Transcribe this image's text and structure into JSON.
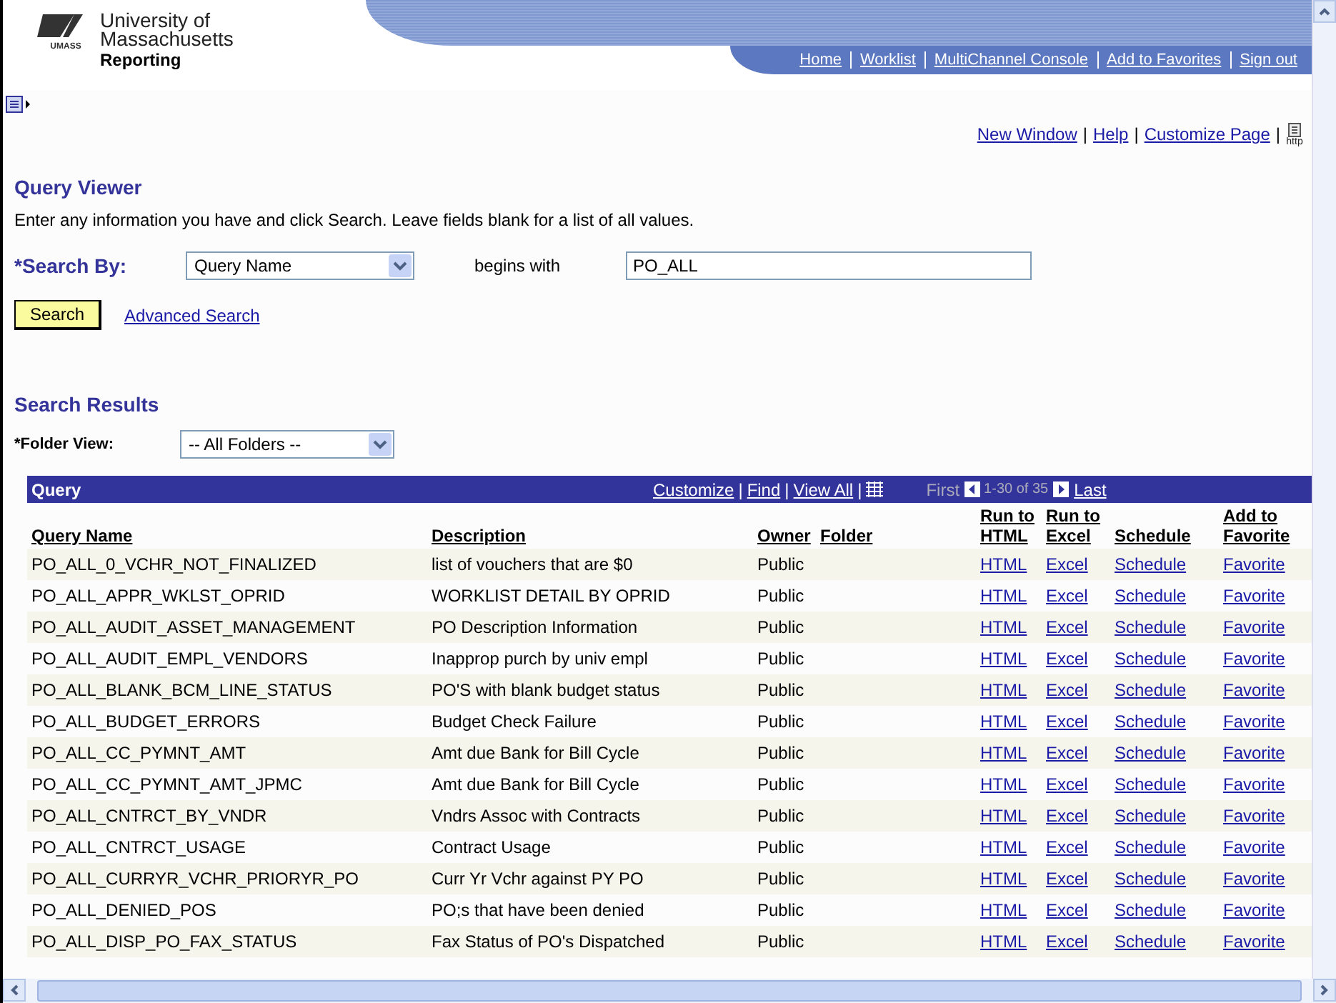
{
  "header": {
    "logo_lines": [
      "University of",
      "Massachusetts"
    ],
    "logo_small": "UMASS",
    "app_name": "Reporting",
    "nav": [
      "Home",
      "Worklist",
      "MultiChannel Console",
      "Add to Favorites",
      "Sign out"
    ]
  },
  "page_links": [
    "New Window",
    "Help",
    "Customize Page"
  ],
  "separator": "|",
  "http_label": "http",
  "title": "Query Viewer",
  "instructions": "Enter any information you have and click Search. Leave fields blank for a list of all values.",
  "search": {
    "label": "*Search By:",
    "field": "Query Name",
    "operator": "begins with",
    "value": "PO_ALL",
    "button": "Search",
    "advanced": "Advanced Search"
  },
  "results_title": "Search Results",
  "folder": {
    "label": "*Folder View:",
    "value": "-- All Folders --"
  },
  "grid": {
    "title": "Query",
    "tools": [
      "Customize",
      "Find",
      "View All"
    ],
    "first": "First",
    "range": "1-30 of 35",
    "last": "Last",
    "columns": [
      {
        "label": "Query Name"
      },
      {
        "label": "Description"
      },
      {
        "label": "Owner"
      },
      {
        "label": "Folder"
      },
      {
        "label": "Run to HTML"
      },
      {
        "label": "Run to Excel"
      },
      {
        "label": "Schedule"
      },
      {
        "label": "Add to Favorite"
      }
    ],
    "rows": [
      {
        "name": "PO_ALL_0_VCHR_NOT_FINALIZED",
        "description": "list of vouchers that are $0",
        "owner": "Public",
        "html": "HTML",
        "excel": "Excel",
        "schedule": "Schedule",
        "favorite": "Favorite"
      },
      {
        "name": "PO_ALL_APPR_WKLST_OPRID",
        "description": "WORKLIST DETAIL BY OPRID",
        "owner": "Public",
        "html": "HTML",
        "excel": "Excel",
        "schedule": "Schedule",
        "favorite": "Favorite"
      },
      {
        "name": "PO_ALL_AUDIT_ASSET_MANAGEMENT",
        "description": "PO Description Information",
        "owner": "Public",
        "html": "HTML",
        "excel": "Excel",
        "schedule": "Schedule",
        "favorite": "Favorite"
      },
      {
        "name": "PO_ALL_AUDIT_EMPL_VENDORS",
        "description": "Inapprop purch by univ empl",
        "owner": "Public",
        "html": "HTML",
        "excel": "Excel",
        "schedule": "Schedule",
        "favorite": "Favorite"
      },
      {
        "name": "PO_ALL_BLANK_BCM_LINE_STATUS",
        "description": "PO'S with blank budget status",
        "owner": "Public",
        "html": "HTML",
        "excel": "Excel",
        "schedule": "Schedule",
        "favorite": "Favorite"
      },
      {
        "name": "PO_ALL_BUDGET_ERRORS",
        "description": "Budget Check Failure",
        "owner": "Public",
        "html": "HTML",
        "excel": "Excel",
        "schedule": "Schedule",
        "favorite": "Favorite"
      },
      {
        "name": "PO_ALL_CC_PYMNT_AMT",
        "description": "Amt due Bank for Bill Cycle",
        "owner": "Public",
        "html": "HTML",
        "excel": "Excel",
        "schedule": "Schedule",
        "favorite": "Favorite"
      },
      {
        "name": "PO_ALL_CC_PYMNT_AMT_JPMC",
        "description": "Amt due Bank for Bill Cycle",
        "owner": "Public",
        "html": "HTML",
        "excel": "Excel",
        "schedule": "Schedule",
        "favorite": "Favorite"
      },
      {
        "name": "PO_ALL_CNTRCT_BY_VNDR",
        "description": "Vndrs Assoc with Contracts",
        "owner": "Public",
        "html": "HTML",
        "excel": "Excel",
        "schedule": "Schedule",
        "favorite": "Favorite"
      },
      {
        "name": "PO_ALL_CNTRCT_USAGE",
        "description": "Contract Usage",
        "owner": "Public",
        "html": "HTML",
        "excel": "Excel",
        "schedule": "Schedule",
        "favorite": "Favorite"
      },
      {
        "name": "PO_ALL_CURRYR_VCHR_PRIORYR_PO",
        "description": "Curr Yr Vchr against PY PO",
        "owner": "Public",
        "html": "HTML",
        "excel": "Excel",
        "schedule": "Schedule",
        "favorite": "Favorite"
      },
      {
        "name": "PO_ALL_DENIED_POS",
        "description": "PO;s that have been denied",
        "owner": "Public",
        "html": "HTML",
        "excel": "Excel",
        "schedule": "Schedule",
        "favorite": "Favorite"
      },
      {
        "name": "PO_ALL_DISP_PO_FAX_STATUS",
        "description": "Fax Status of PO's Dispatched",
        "owner": "Public",
        "html": "HTML",
        "excel": "Excel",
        "schedule": "Schedule",
        "favorite": "Favorite"
      }
    ]
  }
}
